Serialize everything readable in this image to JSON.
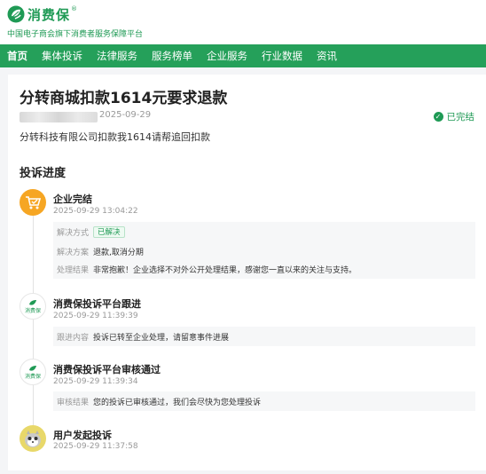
{
  "brand": {
    "name": "消费保",
    "registered": "®",
    "tagline": "中国电子商会旗下消费者服务保障平台",
    "color": "#1f9a55"
  },
  "nav": {
    "items": [
      "首页",
      "集体投诉",
      "法律服务",
      "服务榜单",
      "企业服务",
      "行业数据",
      "资讯"
    ],
    "active_index": 0,
    "background": "#25a05a"
  },
  "complaint": {
    "title": "分转商城扣款1614元要求退款",
    "date": "2025-09-29",
    "status": "已完结",
    "summary": "分转科技有限公司扣款我1614请帮追回扣款"
  },
  "progress": {
    "heading": "投诉进度",
    "events": [
      {
        "title": "企业完结",
        "time": "2025-09-29 13:04:22",
        "avatar_icon": "merchant-cart-icon",
        "details": [
          {
            "label": "解决方式",
            "value": "已解决",
            "badge": true
          },
          {
            "label": "解决方案",
            "value": "退款,取消分期"
          },
          {
            "label": "处理结果",
            "value": "非常抱歉！企业选择不对外公开处理结果，感谢您一直以来的关注与支持。"
          }
        ]
      },
      {
        "title": "消费保投诉平台跟进",
        "time": "2025-09-29 11:39:39",
        "avatar_icon": "xiaofeibao-logo-icon",
        "avatar_text": "消费保",
        "details": [
          {
            "label": "跟进内容",
            "value": "投诉已转至企业处理，请留意事件进展"
          }
        ]
      },
      {
        "title": "消费保投诉平台审核通过",
        "time": "2025-09-29 11:39:34",
        "avatar_icon": "xiaofeibao-logo-icon",
        "avatar_text": "消费保",
        "details": [
          {
            "label": "审核结果",
            "value": "您的投诉已审核通过，我们会尽快为您处理投诉"
          }
        ]
      },
      {
        "title": "用户发起投诉",
        "time": "2025-09-29 11:37:58",
        "avatar_icon": "user-avatar-icon"
      }
    ]
  }
}
